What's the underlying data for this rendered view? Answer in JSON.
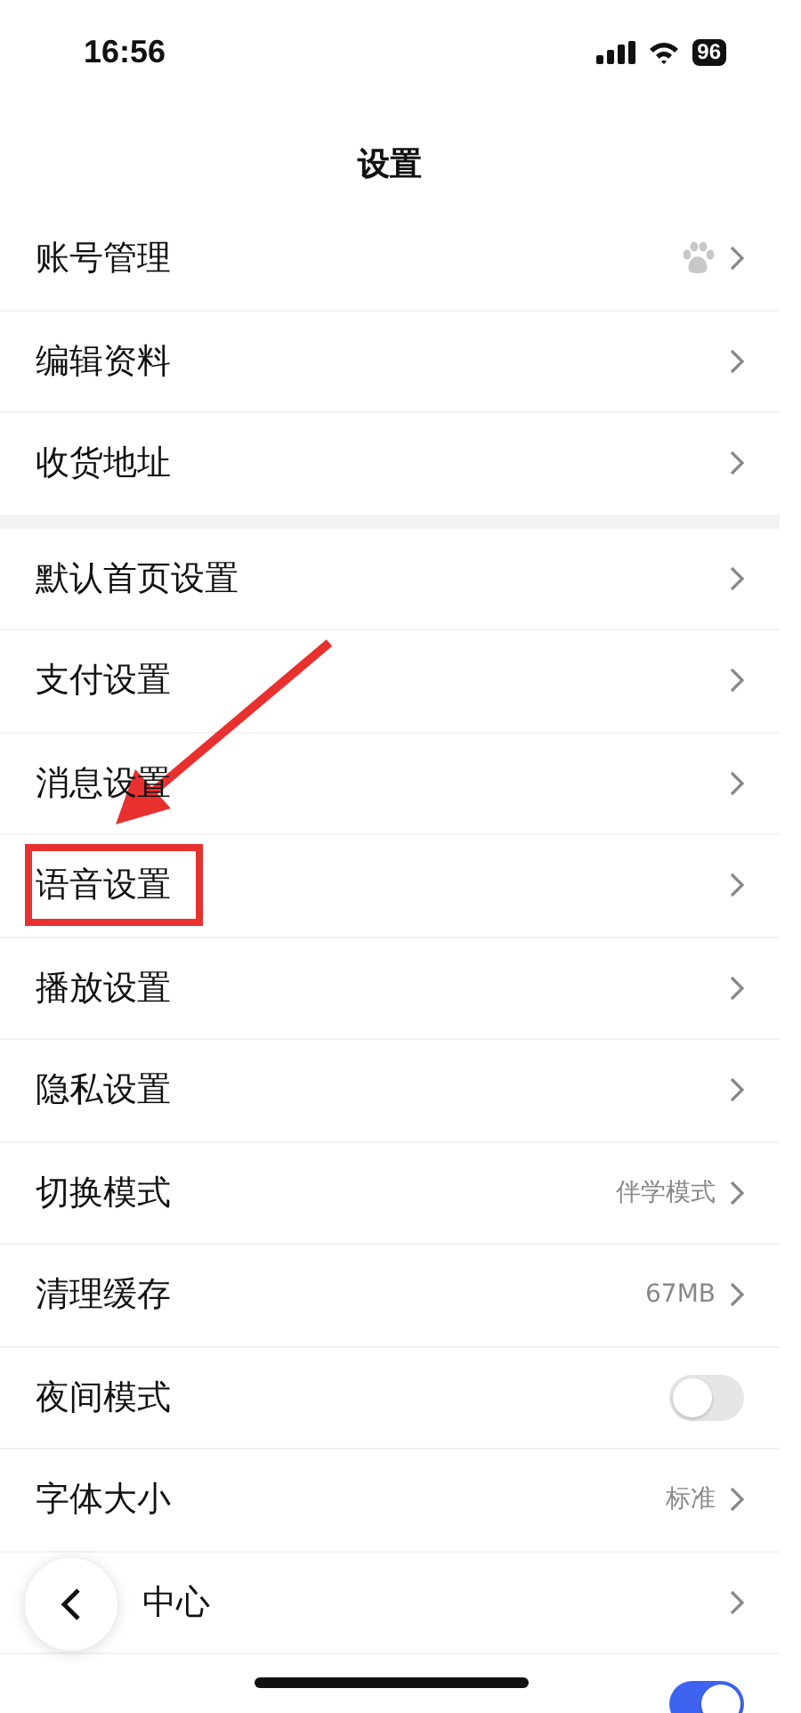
{
  "status_bar": {
    "time": "16:56",
    "battery": "96"
  },
  "title": "设置",
  "groups": [
    {
      "rows": [
        {
          "kind": "icon",
          "label": "账号管理",
          "highlighted": false
        },
        {
          "kind": "link",
          "label": "编辑资料",
          "highlighted": false
        },
        {
          "kind": "link",
          "label": "收货地址",
          "highlighted": false
        }
      ]
    },
    {
      "rows": [
        {
          "kind": "link",
          "label": "默认首页设置",
          "highlighted": false
        },
        {
          "kind": "link",
          "label": "支付设置",
          "highlighted": false
        },
        {
          "kind": "link",
          "label": "消息设置",
          "highlighted": false
        },
        {
          "kind": "link",
          "label": "语音设置",
          "highlighted": true
        },
        {
          "kind": "link",
          "label": "播放设置",
          "highlighted": false
        },
        {
          "kind": "link",
          "label": "隐私设置",
          "highlighted": false
        },
        {
          "kind": "link",
          "label": "切换模式",
          "value": "伴学模式",
          "highlighted": false
        },
        {
          "kind": "link",
          "label": "清理缓存",
          "value": "67MB",
          "highlighted": false
        },
        {
          "kind": "toggle",
          "label": "夜间模式",
          "on": false,
          "highlighted": false
        },
        {
          "kind": "link",
          "label": "字体大小",
          "value": "标准",
          "highlighted": false
        },
        {
          "kind": "covered",
          "label": "中心",
          "highlighted": false
        },
        {
          "kind": "toggle",
          "on": true,
          "highlighted": false
        }
      ]
    }
  ]
}
